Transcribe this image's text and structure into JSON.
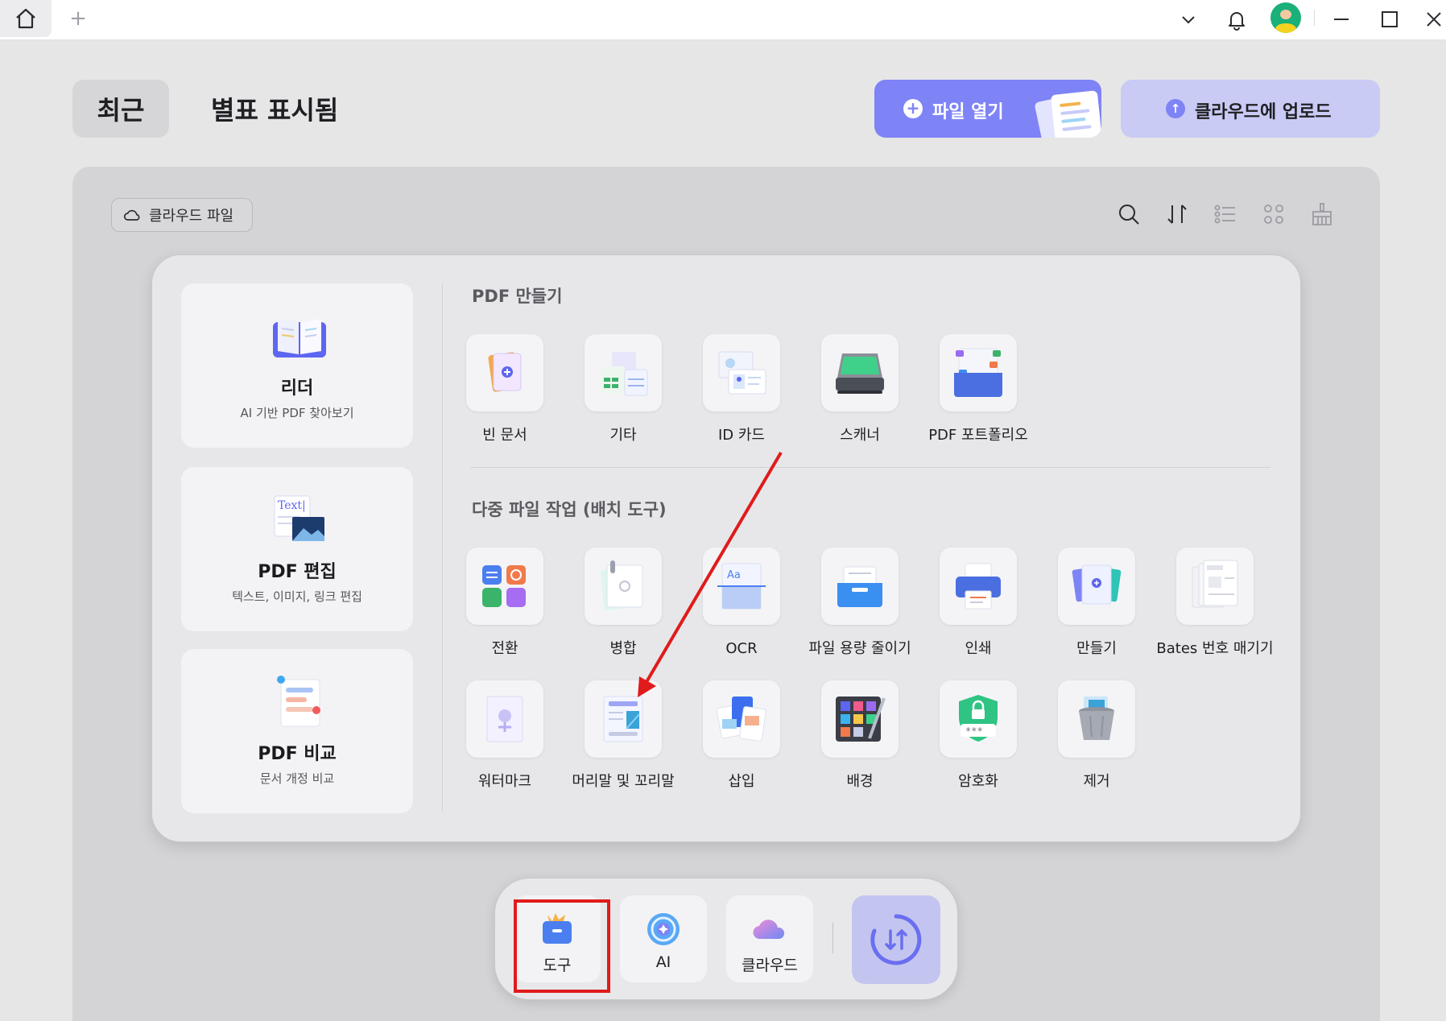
{
  "tabs": {
    "recent": "최근",
    "starred": "별표 표시됨"
  },
  "actions": {
    "open_file": "파일 열기",
    "upload_cloud": "클라우드에 업로드"
  },
  "toolbar": {
    "cloud_files": "클라우드 파일"
  },
  "sidebar": {
    "items": [
      {
        "title": "리더",
        "subtitle": "AI 기반 PDF 찾아보기"
      },
      {
        "title": "PDF 편집",
        "subtitle": "텍스트, 이미지, 링크 편집"
      },
      {
        "title": "PDF 비교",
        "subtitle": "문서 개정 비교"
      }
    ]
  },
  "edit_art_text": "Text|",
  "create_section": {
    "title": "PDF 만들기",
    "items": [
      "빈 문서",
      "기타",
      "ID 카드",
      "스캐너",
      "PDF 포트폴리오"
    ]
  },
  "batch_section": {
    "title": "다중 파일 작업 (배치 도구)",
    "row1": [
      "전환",
      "병합",
      "OCR",
      "파일 용량 줄이기",
      "인쇄",
      "만들기",
      "Bates 번호 매기기"
    ],
    "row2": [
      "워터마크",
      "머리말 및 꼬리말",
      "삽입",
      "배경",
      "암호화",
      "제거"
    ]
  },
  "dock": {
    "tools": "도구",
    "ai": "AI",
    "cloud": "클라우드"
  },
  "colors": {
    "accent": "#7e83f6",
    "accent_light": "#c9cbf4",
    "annotation": "#e01b1b"
  }
}
